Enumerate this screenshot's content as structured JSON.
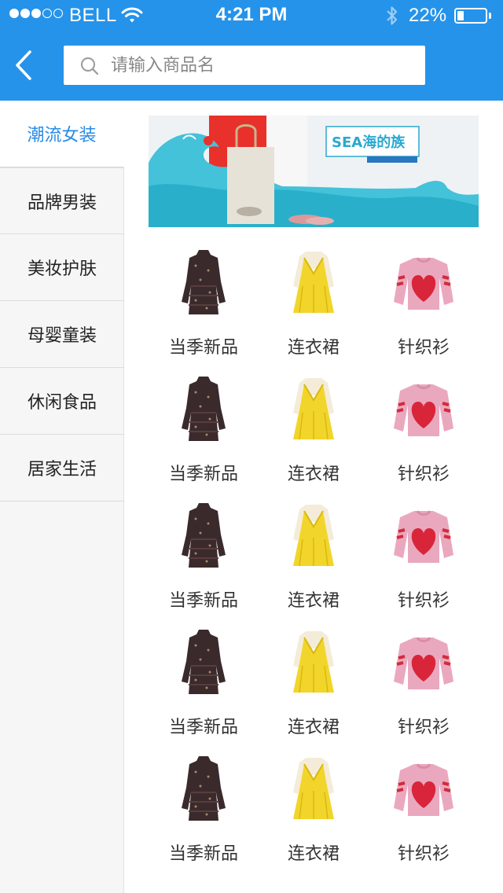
{
  "status_bar": {
    "carrier": "BELL",
    "time": "4:21 PM",
    "battery": "22%",
    "battery_level": 0.22
  },
  "header": {
    "back_icon": "chevron-left-icon",
    "search": {
      "placeholder": "请输入商品名",
      "value": "",
      "icon": "search-icon"
    }
  },
  "sidebar": {
    "categories": [
      {
        "label": "潮流女装",
        "active": true
      },
      {
        "label": "品牌男装",
        "active": false
      },
      {
        "label": "美妆护肤",
        "active": false
      },
      {
        "label": "母婴童装",
        "active": false
      },
      {
        "label": "休闲食品",
        "active": false
      },
      {
        "label": "居家生活",
        "active": false
      }
    ]
  },
  "banner": {
    "brand": "SEA海的族"
  },
  "products": [
    {
      "label": "当季新品",
      "icon": "floral-dress-icon"
    },
    {
      "label": "连衣裙",
      "icon": "yellow-dress-icon"
    },
    {
      "label": "针织衫",
      "icon": "heart-sweater-icon"
    },
    {
      "label": "当季新品",
      "icon": "floral-dress-icon"
    },
    {
      "label": "连衣裙",
      "icon": "yellow-dress-icon"
    },
    {
      "label": "针织衫",
      "icon": "heart-sweater-icon"
    },
    {
      "label": "当季新品",
      "icon": "floral-dress-icon"
    },
    {
      "label": "连衣裙",
      "icon": "yellow-dress-icon"
    },
    {
      "label": "针织衫",
      "icon": "heart-sweater-icon"
    },
    {
      "label": "当季新品",
      "icon": "floral-dress-icon"
    },
    {
      "label": "连衣裙",
      "icon": "yellow-dress-icon"
    },
    {
      "label": "针织衫",
      "icon": "heart-sweater-icon"
    },
    {
      "label": "当季新品",
      "icon": "floral-dress-icon"
    },
    {
      "label": "连衣裙",
      "icon": "yellow-dress-icon"
    },
    {
      "label": "针织衫",
      "icon": "heart-sweater-icon"
    }
  ],
  "colors": {
    "header_bg": "#2593ea",
    "accent": "#2a8ce6",
    "sidebar_bg": "#f6f6f6"
  }
}
